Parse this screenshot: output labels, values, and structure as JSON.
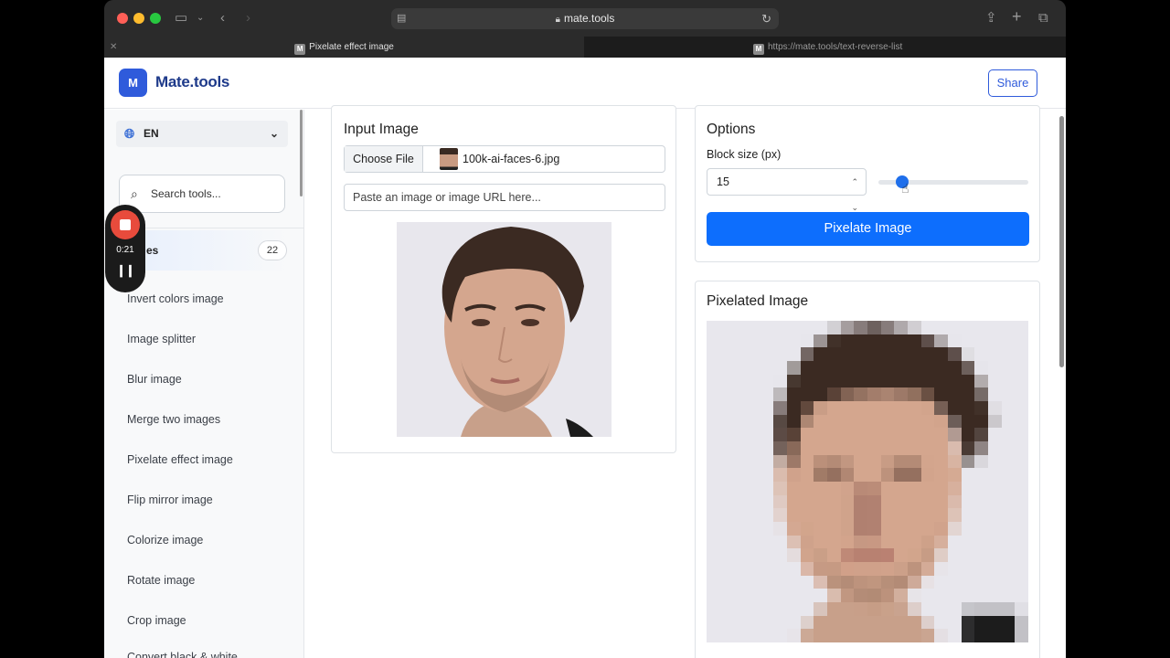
{
  "browser": {
    "url": "mate.tools",
    "tabs": [
      {
        "label": "Pixelate effect image",
        "favicon": "M"
      },
      {
        "label": "https://mate.tools/text-reverse-list",
        "favicon": "M"
      }
    ]
  },
  "header": {
    "logo_letter": "M",
    "brand": "Mate.tools",
    "share_label": "Share"
  },
  "sidebar": {
    "language": "EN",
    "search_placeholder": "Search tools...",
    "category": {
      "label": "Images",
      "visible_label": "es",
      "count": "22"
    },
    "items": [
      "Invert colors image",
      "Image splitter",
      "Blur image",
      "Merge two images",
      "Pixelate effect image",
      "Flip mirror image",
      "Colorize image",
      "Rotate image",
      "Crop image",
      "Convert black & white"
    ]
  },
  "recorder": {
    "time": "0:21"
  },
  "input_card": {
    "title": "Input Image",
    "choose_file": "Choose File",
    "file_name": "100k-ai-faces-6.jpg",
    "url_placeholder": "Paste an image or image URL here..."
  },
  "options_card": {
    "title": "Options",
    "block_size_label": "Block size (px)",
    "block_size_value": "15",
    "slider_fraction": 0.16,
    "button_label": "Pixelate Image"
  },
  "output_card": {
    "title": "Pixelated Image"
  },
  "colors": {
    "brand": "#2f5bdb",
    "primary_button": "#0d6efd",
    "record": "#e84b3c"
  }
}
